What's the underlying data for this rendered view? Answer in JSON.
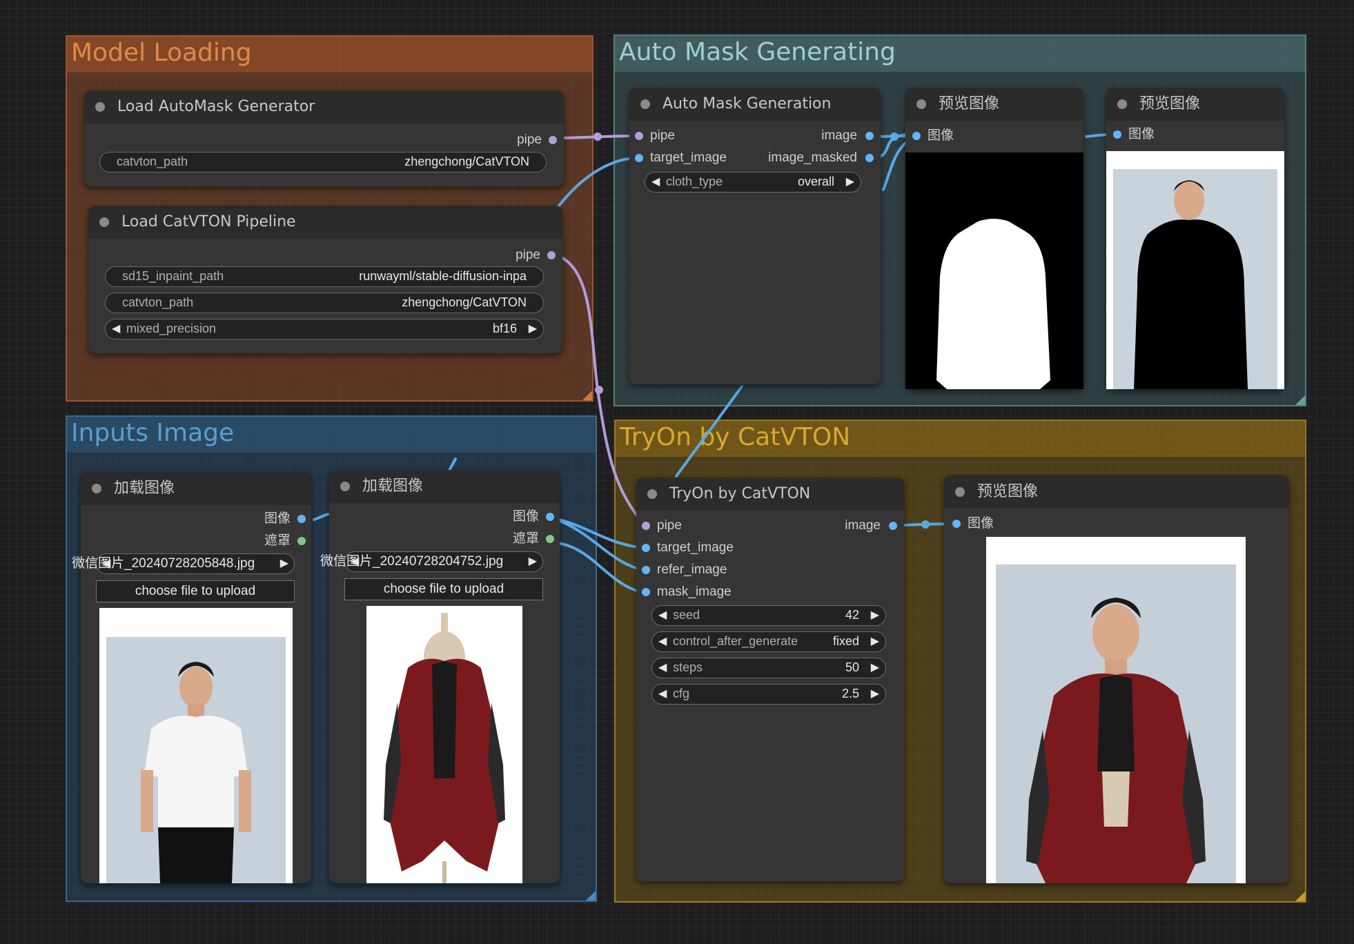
{
  "colors": {
    "canvas_bg": "#1e1e1e",
    "model_group": "#8a4a2a",
    "mask_group": "#3a5a5a",
    "inputs_group": "#2a4a66",
    "tryon_group": "#7a5e16",
    "pipe_slot": "#b39ddb",
    "image_slot": "#64b5f6",
    "mask_slot": "#81c784"
  },
  "groups": {
    "model_loading": "Model Loading",
    "auto_mask": "Auto Mask Generating",
    "inputs_image": "Inputs Image",
    "tryon": "TryOn by CatVTON"
  },
  "nodes": {
    "load_automask": {
      "title": "Load AutoMask Generator",
      "output_pipe": "pipe",
      "catvton_path_label": "catvton_path",
      "catvton_path_value": "zhengchong/CatVTON"
    },
    "load_catvton": {
      "title": "Load CatVTON Pipeline",
      "output_pipe": "pipe",
      "sd15_label": "sd15_inpaint_path",
      "sd15_value": "runwayml/stable-diffusion-inpa",
      "catvton_path_label": "catvton_path",
      "catvton_path_value": "zhengchong/CatVTON",
      "precision_label": "mixed_precision",
      "precision_value": "bf16"
    },
    "auto_mask": {
      "title": "Auto Mask Generation",
      "in_pipe": "pipe",
      "in_target": "target_image",
      "out_image": "image",
      "out_masked": "image_masked",
      "cloth_label": "cloth_type",
      "cloth_value": "overall"
    },
    "preview_1": {
      "title": "预览图像",
      "in_image": "图像",
      "image_icon": "white-mask-silhouette-image"
    },
    "preview_2": {
      "title": "预览图像",
      "in_image": "图像",
      "image_icon": "masked-person-image"
    },
    "load_image_1": {
      "title": "加载图像",
      "out_image": "图像",
      "out_mask": "遮罩",
      "file_value": "微信图片_20240728205848.jpg",
      "upload_label": "choose file to upload",
      "image_icon": "man-white-tshirt-photo"
    },
    "load_image_2": {
      "title": "加载图像",
      "out_image": "图像",
      "out_mask": "遮罩",
      "file_value": "微信图片_20240728204752.jpg",
      "upload_label": "choose file to upload",
      "image_icon": "red-leather-coat-photo"
    },
    "tryon": {
      "title": "TryOn by CatVTON",
      "in_pipe": "pipe",
      "in_target": "target_image",
      "in_refer": "refer_image",
      "in_mask": "mask_image",
      "out_image": "image",
      "seed_label": "seed",
      "seed_value": "42",
      "control_label": "control_after_generate",
      "control_value": "fixed",
      "steps_label": "steps",
      "steps_value": "50",
      "cfg_label": "cfg",
      "cfg_value": "2.5"
    },
    "preview_3": {
      "title": "预览图像",
      "in_image": "图像",
      "image_icon": "man-wearing-red-coat-photo"
    }
  }
}
